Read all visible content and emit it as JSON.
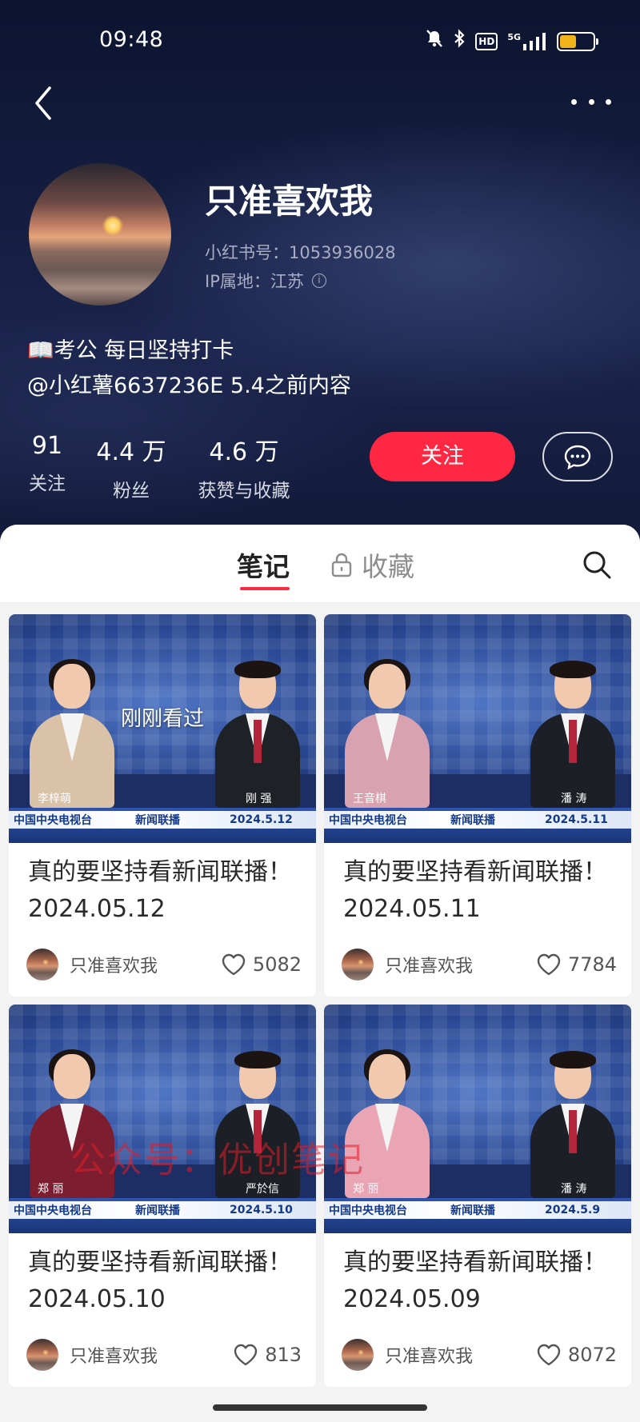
{
  "status_bar": {
    "time": "09:48",
    "icons": [
      "mute-bell-icon",
      "bluetooth-icon",
      "hd-icon",
      "5g-signal-icon",
      "battery-icon"
    ],
    "hd": "HD",
    "network": "5G",
    "battery_level": 0.5,
    "battery_color": "#f0b41a"
  },
  "profile": {
    "name": "只准喜欢我",
    "id_text": "小红书号：1053936028",
    "ip_text": "IP属地：江苏",
    "bio_line1": "📖考公 每日坚持打卡",
    "bio_line2": "@小红薯6637236E 5.4之前内容"
  },
  "stats": [
    {
      "value": "91",
      "label": "关注"
    },
    {
      "value": "4.4 万",
      "label": "粉丝"
    },
    {
      "value": "4.6 万",
      "label": "获赞与收藏"
    }
  ],
  "actions": {
    "follow_label": "关注",
    "accent": "#ff2742"
  },
  "tabs": {
    "notes": "笔记",
    "favorites": "收藏"
  },
  "watched_label": "刚刚看过",
  "watermark": "公众号：优创笔记",
  "notes": [
    {
      "title": "真的要坚持看新闻联播！2024.05.12",
      "author": "只准喜欢我",
      "likes": "5082",
      "channel": "中国中央电视台",
      "program": "新闻联播",
      "date": "2024.5.12",
      "anchor_left": "李梓萌",
      "anchor_right": "刚 强"
    },
    {
      "title": "真的要坚持看新闻联播！2024.05.11",
      "author": "只准喜欢我",
      "likes": "7784",
      "channel": "中国中央电视台",
      "program": "新闻联播",
      "date": "2024.5.11",
      "anchor_left": "王音棋",
      "anchor_right": "潘 涛"
    },
    {
      "title": "真的要坚持看新闻联播！2024.05.10",
      "author": "只准喜欢我",
      "likes": "813",
      "channel": "中国中央电视台",
      "program": "新闻联播",
      "date": "2024.5.10",
      "anchor_left": "郑 丽",
      "anchor_right": "严於信"
    },
    {
      "title": "真的要坚持看新闻联播！2024.05.09",
      "author": "只准喜欢我",
      "likes": "8072",
      "channel": "中国中央电视台",
      "program": "新闻联播",
      "date": "2024.5.9",
      "anchor_left": "郑 丽",
      "anchor_right": "潘 涛"
    }
  ]
}
